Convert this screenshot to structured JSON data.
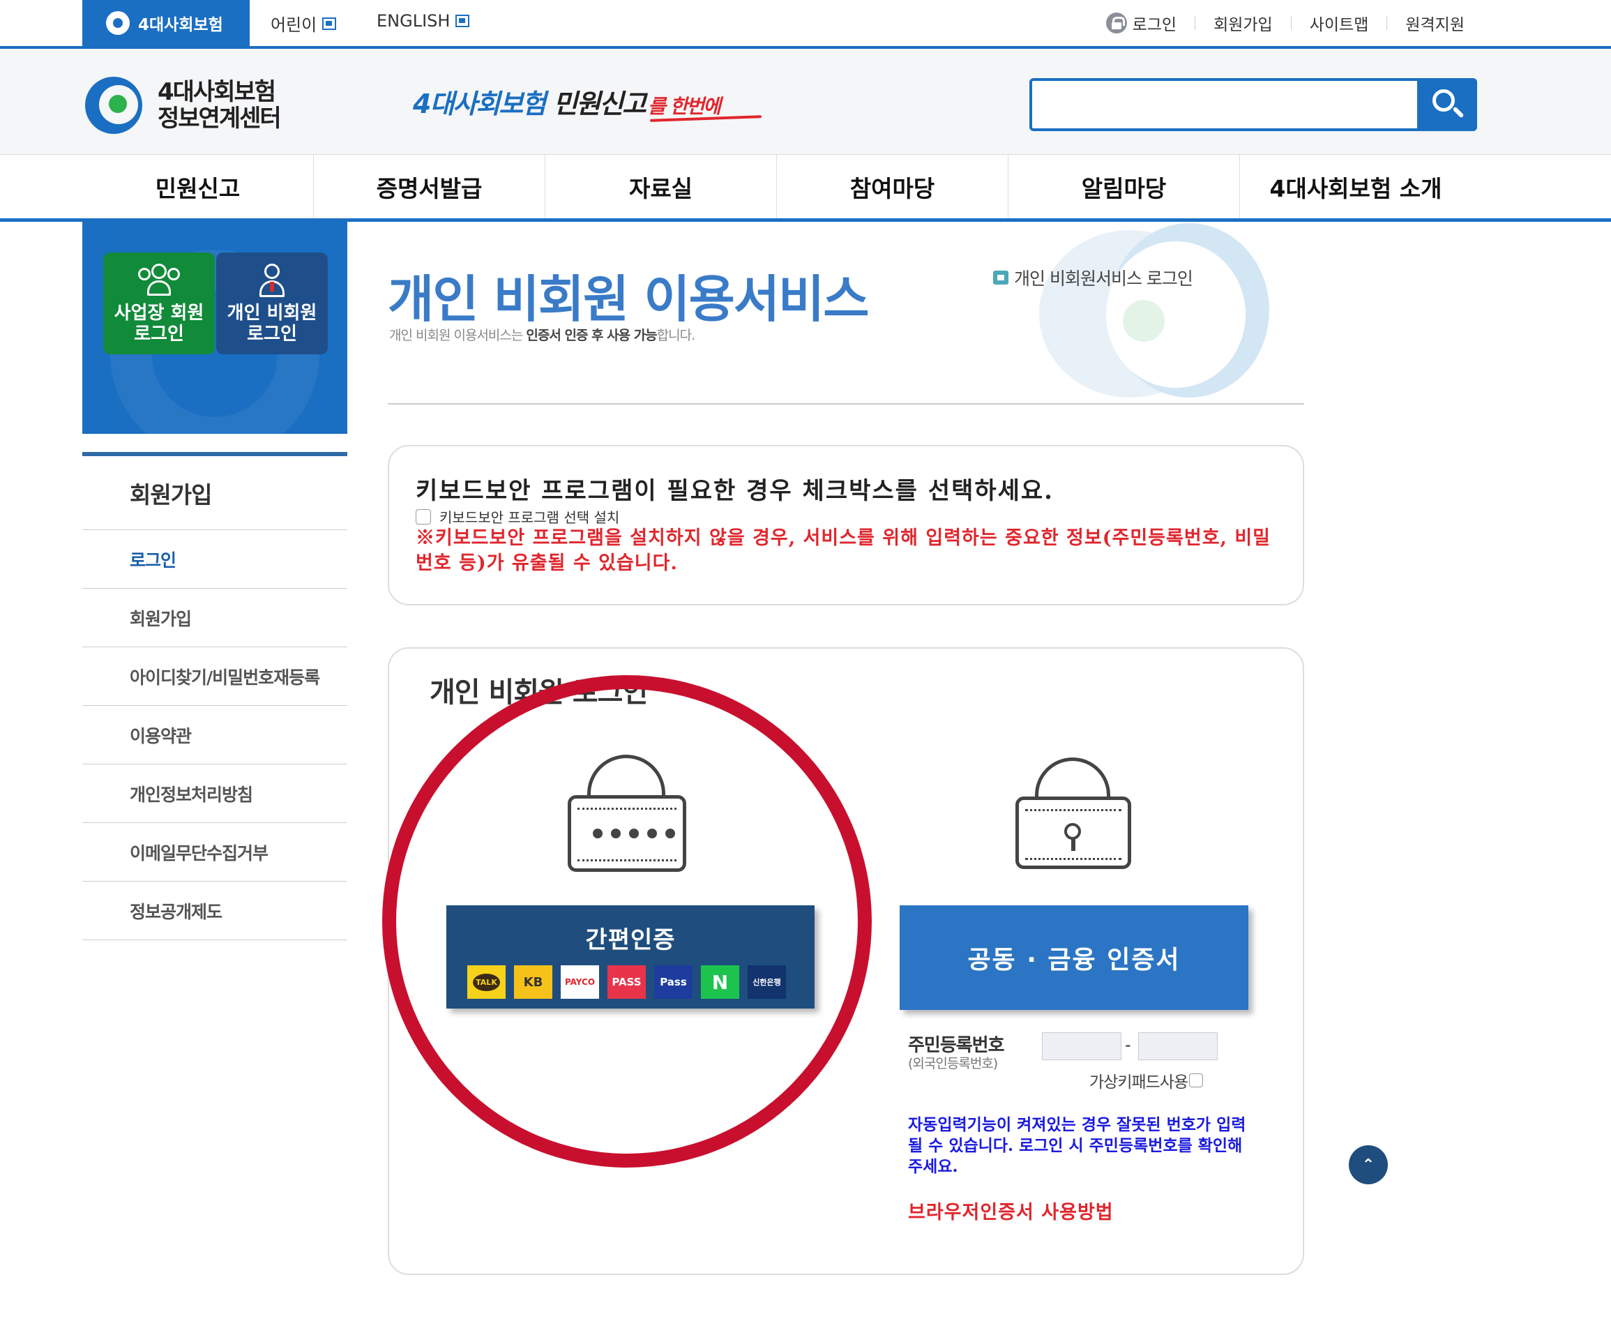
{
  "topbar": {
    "brand_tab": "4대사회보험",
    "kids": "어린이",
    "english": "ENGLISH",
    "login": "로그인",
    "join": "회원가입",
    "sitemap": "사이트맵",
    "remote": "원격지원"
  },
  "header": {
    "logo_line1": "4대사회보험",
    "logo_line2": "정보연계센터",
    "slogan_blue": "4대사회보험",
    "slogan_black": "민원신고",
    "slogan_red": "를 한번에",
    "search_placeholder": ""
  },
  "gnb": [
    "민원신고",
    "증명서발급",
    "자료실",
    "참여마당",
    "알림마당",
    "4대사회보험 소개"
  ],
  "sidebar": {
    "biz_login": [
      "사업장 회원",
      "로그인"
    ],
    "personal_login": [
      "개인 비회원",
      "로그인"
    ],
    "menu_title": "회원가입",
    "items": [
      "로그인",
      "회원가입",
      "아이디찾기/비밀번호재등록",
      "이용약관",
      "개인정보처리방침",
      "이메일무단수집거부",
      "정보공개제도"
    ],
    "active_index": 0
  },
  "content": {
    "title": "개인 비회원 이용서비스",
    "subtitle_pre": "개인 비회원 이용서비스는 ",
    "subtitle_bold": "인증서 인증 후 사용 가능",
    "subtitle_post": "합니다.",
    "breadcrumb": "개인 비회원서비스 로그인"
  },
  "keyboard_security": {
    "question": "키보드보안 프로그램이 필요한 경우 체크박스를 선택하세요.",
    "checkbox_label": "키보드보안 프로그램 선택 설치",
    "warning": "※키보드보안 프로그램을 설치하지 않을 경우, 서비스를 위해 입력하는 중요한 정보(주민등록번호, 비밀번호 등)가 유출될 수 있습니다."
  },
  "login": {
    "title": "개인 비회원 로그인",
    "simple_auth": "간편인증",
    "providers": [
      {
        "name": "kakao",
        "label": "TALK"
      },
      {
        "name": "kb",
        "label": "KB"
      },
      {
        "name": "payco",
        "label": "PAYCO"
      },
      {
        "name": "pass",
        "label": "PASS"
      },
      {
        "name": "samsung-pass",
        "label": "Pass"
      },
      {
        "name": "naver",
        "label": "N"
      },
      {
        "name": "shinhan",
        "label": "신한은행"
      }
    ],
    "cert_button": "공동 · 금융 인증서",
    "rrn_label": "주민등록번호",
    "rrn_sub": "(외국인등록번호)",
    "rrn_dash": "-",
    "rrn_front_value": "",
    "rrn_back_value": "",
    "virtual_keypad": "가상키패드사용",
    "autofill_notice": "자동입력기능이 켜져있는 경우 잘못된 번호가 입력될 수 있습니다. 로그인 시 주민등록번호를 확인해주세요.",
    "browser_cert_link": "브라우저인증서 사용방법"
  },
  "colors": {
    "primary": "#1a6fc2",
    "highlight_circle": "#c8102e",
    "warning": "#e0262d",
    "notice_blue": "#1a1ae0"
  },
  "icons": [
    "lock-icon",
    "external-link-icon",
    "search-icon",
    "home-icon",
    "padlock-icon",
    "padlock-keyhole-icon",
    "scroll-top-icon"
  ]
}
